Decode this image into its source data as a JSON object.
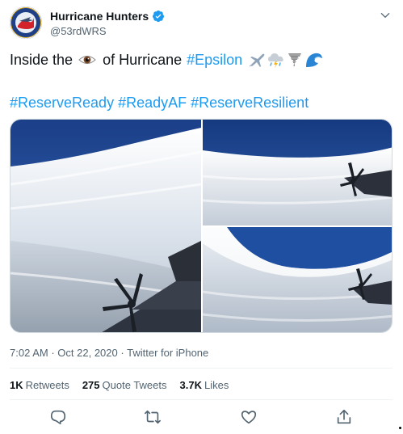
{
  "account": {
    "display_name": "Hurricane Hunters",
    "handle": "@53rdWRS",
    "verified": true,
    "avatar_icon": "squadron-emblem-icon"
  },
  "tweet": {
    "text_before_eye": "Inside the",
    "text_after_eye": "of Hurricane",
    "hashtag_epsilon": "#Epsilon",
    "emojis": [
      "eye",
      "airplane",
      "cloud-with-lightning-and-rain",
      "tornado",
      "water-wave"
    ],
    "hashtags_line2": [
      "#ReserveReady",
      "#ReadyAF",
      "#ReserveResilient"
    ]
  },
  "media": {
    "count": 3,
    "icons": [
      "hurricane-eye-photo-left",
      "hurricane-eye-photo-top-right",
      "hurricane-eye-photo-bottom-right"
    ]
  },
  "meta": {
    "time": "7:02 AM",
    "date": "Oct 22, 2020",
    "source": "Twitter for iPhone",
    "separator": "·"
  },
  "stats": {
    "retweets_value": "1K",
    "retweets_label": "Retweets",
    "quotes_value": "275",
    "quotes_label": "Quote Tweets",
    "likes_value": "3.7K",
    "likes_label": "Likes"
  },
  "actions": [
    "reply-icon",
    "retweet-icon",
    "like-icon",
    "share-icon"
  ],
  "colors": {
    "link": "#1d9bf0",
    "text": "#0f1419",
    "muted": "#536471",
    "divider": "#eff3f4"
  }
}
